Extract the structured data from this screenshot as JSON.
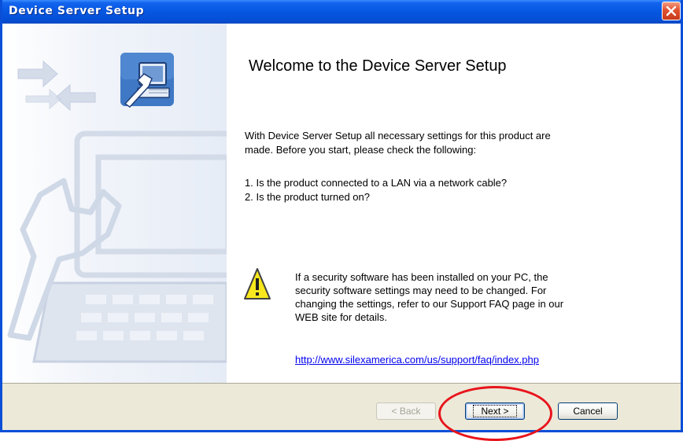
{
  "window": {
    "title": "Device Server Setup"
  },
  "main": {
    "heading": "Welcome to the Device Server Setup",
    "intro_line1": "With Device Server Setup all necessary settings for this product are",
    "intro_line2": "made. Before you start, please check the following:",
    "checklist": [
      "1. Is the product connected to a LAN via a network cable?",
      "2. Is the product turned on?"
    ],
    "warning_lines": [
      "If a security software has been installed on your PC, the",
      "security software settings may need to be changed. For",
      "changing the settings, refer to our Support FAQ page in our",
      "WEB site for details."
    ],
    "support_link": "http://www.silexamerica.com/us/support/faq/index.php"
  },
  "footer": {
    "back_label": "< Back",
    "next_label": "Next >",
    "cancel_label": "Cancel",
    "back_enabled": false
  },
  "icons": {
    "side_graphic": "wrench-computer-illustration",
    "wizard_icon": "computer-wrench-icon",
    "warning": "warning-icon",
    "close": "close-icon"
  },
  "colors": {
    "titlebar": "#0550d8",
    "close_button": "#e0512f",
    "footer_bg": "#ece9d8",
    "link": "#0000ee",
    "annotation": "#e8141c",
    "warning_fill": "#f8e71c"
  }
}
